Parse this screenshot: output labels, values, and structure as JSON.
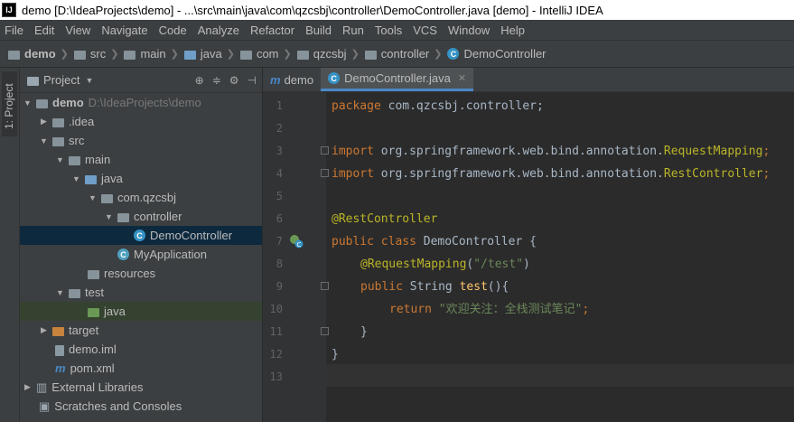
{
  "window": {
    "title": "demo [D:\\IdeaProjects\\demo] - ...\\src\\main\\java\\com\\qzcsbj\\controller\\DemoController.java [demo] - IntelliJ IDEA",
    "logo": "IJ"
  },
  "menu": [
    "File",
    "Edit",
    "View",
    "Navigate",
    "Code",
    "Analyze",
    "Refactor",
    "Build",
    "Run",
    "Tools",
    "VCS",
    "Window",
    "Help"
  ],
  "breadcrumb": [
    "demo",
    "src",
    "main",
    "java",
    "com",
    "qzcsbj",
    "controller",
    "DemoController"
  ],
  "sidebar_tab": "1: Project",
  "project": {
    "title": "Project",
    "tree": [
      {
        "label": "demo",
        "path": "D:\\IdeaProjects\\demo"
      },
      {
        "label": ".idea"
      },
      {
        "label": "src"
      },
      {
        "label": "main"
      },
      {
        "label": "java"
      },
      {
        "label": "com.qzcsbj"
      },
      {
        "label": "controller"
      },
      {
        "label": "DemoController"
      },
      {
        "label": "MyApplication"
      },
      {
        "label": "resources"
      },
      {
        "label": "test"
      },
      {
        "label": "java"
      },
      {
        "label": "target"
      },
      {
        "label": "demo.iml"
      },
      {
        "label": "pom.xml"
      },
      {
        "label": "External Libraries"
      },
      {
        "label": "Scratches and Consoles"
      }
    ]
  },
  "editor": {
    "tabs": [
      {
        "label": "demo",
        "icon": "m"
      },
      {
        "label": "DemoController.java",
        "icon": "C"
      }
    ],
    "line_numbers": [
      "1",
      "2",
      "3",
      "4",
      "5",
      "6",
      "7",
      "8",
      "9",
      "10",
      "11",
      "12",
      "13"
    ],
    "code": {
      "l1_kw": "package",
      "l1_rest": " com.qzcsbj.controller;",
      "l3_kw": "import",
      "l3_rest": " org.springframework.web.bind.annotation.",
      "l3_cls": "RequestMapping",
      "l3_end": ";",
      "l4_kw": "import",
      "l4_rest": " org.springframework.web.bind.annotation.",
      "l4_cls": "RestController",
      "l4_end": ";",
      "l6_ann": "@RestController",
      "l7_kw": "public class",
      "l7_rest": " DemoController {",
      "l8_ann": "@RequestMapping",
      "l8_open": "(",
      "l8_str": "\"/test\"",
      "l8_close": ")",
      "l9_kw": "public",
      "l9_rest": " String ",
      "l9_name": "test",
      "l9_end": "(){",
      "l10_kw": "return",
      "l10_str": " \"欢迎关注：全栈测试笔记\"",
      "l10_end": ";",
      "l11": "}",
      "l12": "}"
    }
  },
  "colors": {
    "keyword": "#cc7832",
    "annotation": "#bbb529",
    "string": "#6a8759",
    "text": "#a9b7c6",
    "accent": "#4a88c7"
  }
}
